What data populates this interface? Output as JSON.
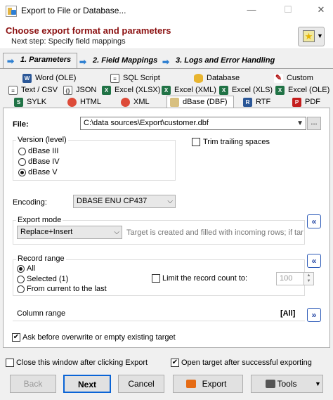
{
  "window": {
    "title": "Export to File or Database...",
    "minimize": "—",
    "maximize": "☐",
    "close": "✕"
  },
  "header": {
    "title": "Choose export format and parameters",
    "subtitle": "Next step: Specify field mappings"
  },
  "main_tabs": [
    {
      "label": "1. Parameters",
      "active": true
    },
    {
      "label": "2. Field Mappings",
      "active": false
    },
    {
      "label": "3. Logs and Error Handling",
      "active": false
    }
  ],
  "format_tabs": {
    "row1": [
      "Word (OLE)",
      "SQL Script",
      "Database",
      "Custom"
    ],
    "row2": [
      "Text / CSV",
      "JSON",
      "Excel (XLSX)",
      "Excel (XML)",
      "Excel (XLS)",
      "Excel (OLE)"
    ],
    "row3": [
      "SYLK",
      "HTML",
      "XML",
      "dBase (DBF)",
      "RTF",
      "PDF"
    ],
    "selected": "dBase (DBF)"
  },
  "file": {
    "label": "File:",
    "value": "C:\\data sources\\Export\\customer.dbf",
    "browse": "..."
  },
  "version": {
    "title": "Version (level)",
    "options": [
      "dBase III",
      "dBase IV",
      "dBase V"
    ],
    "selected": "dBase V"
  },
  "trim": {
    "label": "Trim trailing spaces",
    "checked": false
  },
  "encoding": {
    "label": "Encoding:",
    "value": "DBASE ENU CP437"
  },
  "export_mode": {
    "title": "Export mode",
    "value": "Replace+Insert",
    "hint": "Target is created and filled with incoming rows; if target..."
  },
  "record_range": {
    "title": "Record range",
    "options": [
      "All",
      "Selected (1)",
      "From current to the last"
    ],
    "selected": "All",
    "limit_label": "Limit the record count to:",
    "limit_value": "100"
  },
  "column_range": {
    "title": "Column range",
    "value": "[All]"
  },
  "ask_overwrite": {
    "label": "Ask before overwrite or empty existing target",
    "checked": true
  },
  "close_after": {
    "label": "Close this window after clicking Export",
    "checked": false
  },
  "open_target": {
    "label": "Open target after successful exporting",
    "checked": true
  },
  "buttons": {
    "back": "Back",
    "next": "Next",
    "cancel": "Cancel",
    "export": "Export",
    "tools": "Tools"
  },
  "colors": {
    "header_title": "#8b1010",
    "accent_blue": "#2d7fd1"
  }
}
